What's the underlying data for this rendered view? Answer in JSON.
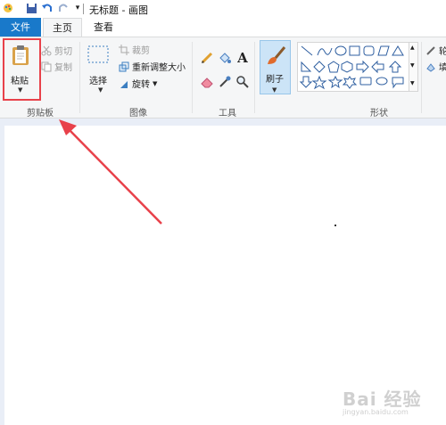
{
  "window": {
    "title": "无标题 - 画图"
  },
  "tabs": {
    "file": "文件",
    "home": "主页",
    "view": "查看"
  },
  "clipboard": {
    "paste_label": "粘贴",
    "cut_label": "剪切",
    "copy_label": "复制",
    "group_label": "剪贴板"
  },
  "image": {
    "select_label": "选择",
    "crop_label": "裁剪",
    "resize_label": "重新调整大小",
    "rotate_label": "旋转",
    "group_label": "图像"
  },
  "tools": {
    "group_label": "工具",
    "text_glyph": "A"
  },
  "brushes": {
    "label": "刷子"
  },
  "shapes": {
    "group_label": "形状",
    "outline_label": "轮",
    "fill_label": "填"
  },
  "colors": {
    "accent": "#1979ca",
    "highlight": "#e8414a",
    "ribbon": "#f5f6f7",
    "canvas_bg": "#e9eef7"
  },
  "watermark": {
    "brand": "Bai 经验",
    "url": "jingyan.baidu.com"
  }
}
